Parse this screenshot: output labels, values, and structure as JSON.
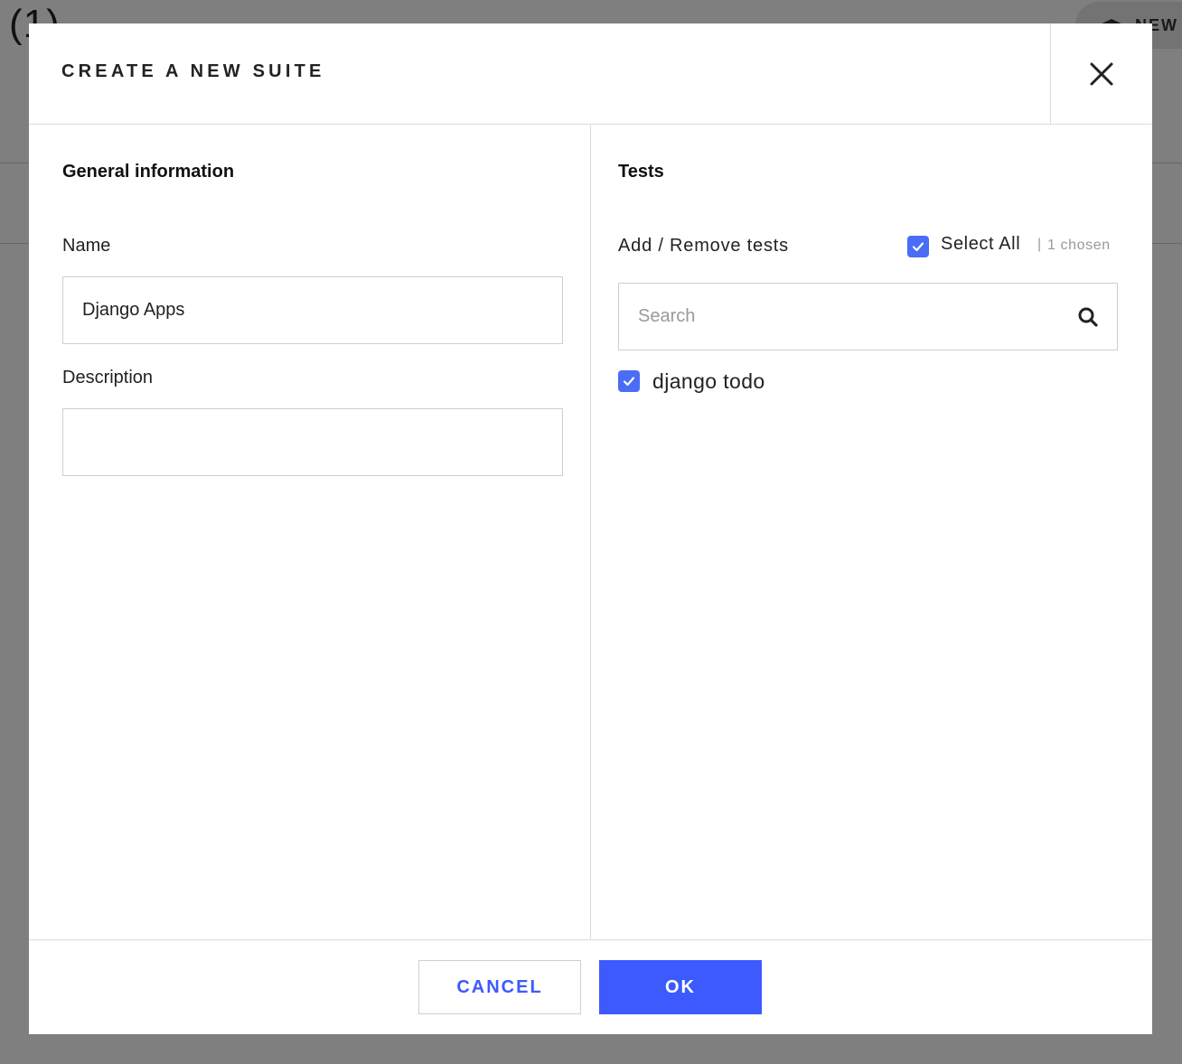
{
  "background": {
    "count": "(1)",
    "new_button_label": "NEW"
  },
  "modal": {
    "title": "CREATE A NEW SUITE",
    "close_icon": "close-icon"
  },
  "general": {
    "title": "General information",
    "name_label": "Name",
    "name_value": "Django Apps",
    "description_label": "Description",
    "description_value": ""
  },
  "tests": {
    "title": "Tests",
    "add_remove_label": "Add / Remove tests",
    "select_all_label": "Select All",
    "select_all_checked": true,
    "chosen_separator": "|",
    "chosen_count": "1 chosen",
    "search_placeholder": "Search",
    "search_icon": "search-icon",
    "items": [
      {
        "label": "django todo",
        "checked": true
      }
    ]
  },
  "footer": {
    "cancel_label": "CANCEL",
    "ok_label": "OK"
  },
  "colors": {
    "accent": "#3d5afe",
    "checkbox": "#4a6cf7",
    "border": "#cfcfcf",
    "overlay": "rgba(0,0,0,0.5)"
  }
}
